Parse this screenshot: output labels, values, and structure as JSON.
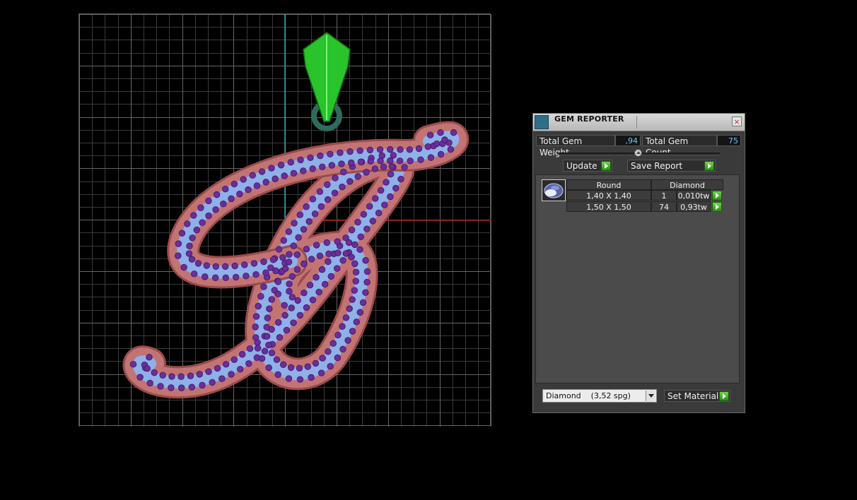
{
  "gem_reporter": {
    "title": "GEM REPORTER",
    "total_weight_label": "Total Gem Weight",
    "total_weight_value": ",94",
    "total_count_label": "Total Gem Count",
    "total_count_value": "75",
    "update_label": "Update",
    "save_report_label": "Save Report",
    "table": {
      "shape_header": "Round",
      "material_header": "Diamond",
      "rows": [
        {
          "size": "1,40 X 1,40",
          "count": "1",
          "weight": "0,010tw"
        },
        {
          "size": "1,50 X 1,50",
          "count": "74",
          "weight": "0,93tw"
        }
      ]
    },
    "material_select_value": "Diamond    (3,52 spg)",
    "set_material_label": "Set Material",
    "close_icon": "×"
  },
  "colors": {
    "accent_green": "#3cbf2a",
    "value_cyan": "#69c8ea",
    "pendant_pink": "#b87070",
    "gem_blue": "#8aaee8",
    "gem_purple": "#6a2e9a"
  }
}
